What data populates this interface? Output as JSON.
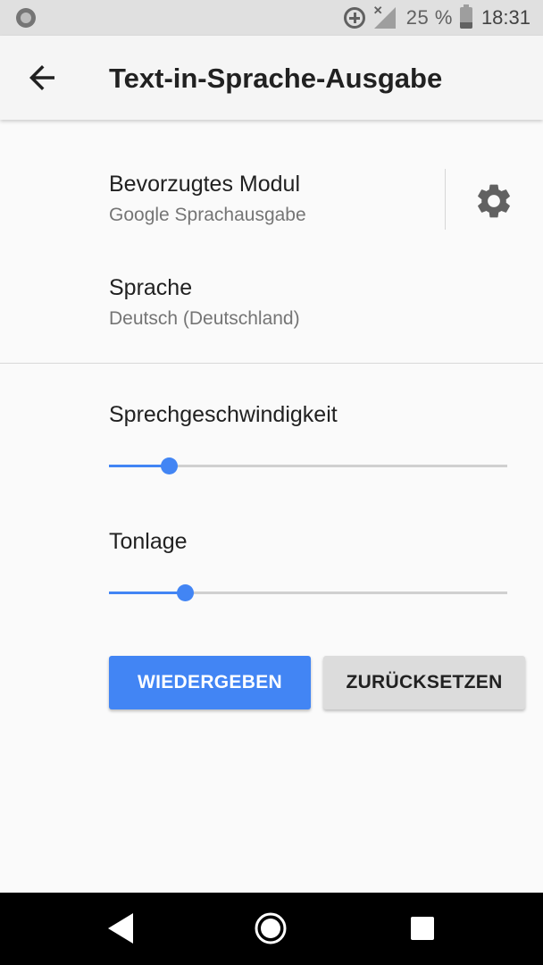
{
  "status_bar": {
    "battery_percent": "25 %",
    "time": "18:31",
    "icons": [
      "notification-dot-icon",
      "data-saver-icon",
      "signal-no-data-icon",
      "battery-charging-icon"
    ]
  },
  "app_bar": {
    "title": "Text-in-Sprache-Ausgabe",
    "back_icon": "arrow-back-icon"
  },
  "preferences": {
    "module": {
      "title": "Bevorzugtes Modul",
      "summary": "Google Sprachausgabe",
      "settings_icon": "gear-icon"
    },
    "language": {
      "title": "Sprache",
      "summary": "Deutsch (Deutschland)"
    }
  },
  "speech_rate": {
    "label": "Sprechgeschwindigkeit",
    "value": 0.15
  },
  "pitch": {
    "label": "Tonlage",
    "value": 0.19
  },
  "buttons": {
    "play_label": "WIEDERGEBEN",
    "reset_label": "ZURÜCKSETZEN"
  },
  "colors": {
    "accent": "#4285f4",
    "status_bar_bg": "#e0e0e0",
    "app_bar_bg": "#f5f5f5",
    "reset_button_bg": "#dcdcdc"
  },
  "nav_bar": {
    "icons": [
      "nav-back-icon",
      "nav-home-icon",
      "nav-recents-icon"
    ]
  }
}
